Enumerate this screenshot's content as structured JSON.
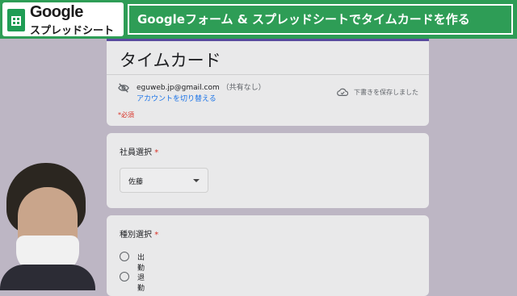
{
  "banner": {
    "badge_line1": "Google",
    "badge_line2": "スプレッドシート",
    "title": "Googleフォーム & スプレッドシートでタイムカードを作る"
  },
  "form": {
    "title": "タイムカード",
    "account_email": "eguweb.jp@gmail.com",
    "account_sharing": "（共有なし）",
    "switch_account_link": "アカウントを切り替える",
    "draft_status": "下書きを保存しました",
    "required_note": "*必須"
  },
  "questions": [
    {
      "title": "社員選択",
      "required_mark": "*",
      "type": "dropdown",
      "selected_value": "佐藤"
    },
    {
      "title": "種別選択",
      "required_mark": "*",
      "type": "radio",
      "options": [
        "出勤",
        "退勤"
      ]
    }
  ],
  "colors": {
    "banner_green": "#2e9d56",
    "form_header_accent": "#5a4aa0",
    "link_blue": "#1a73e8",
    "required_red": "#d93025"
  },
  "icons": {
    "badge": "google-sheets-icon",
    "account": "eye-off-icon",
    "draft": "cloud-done-icon",
    "dropdown": "caret-down-icon"
  }
}
